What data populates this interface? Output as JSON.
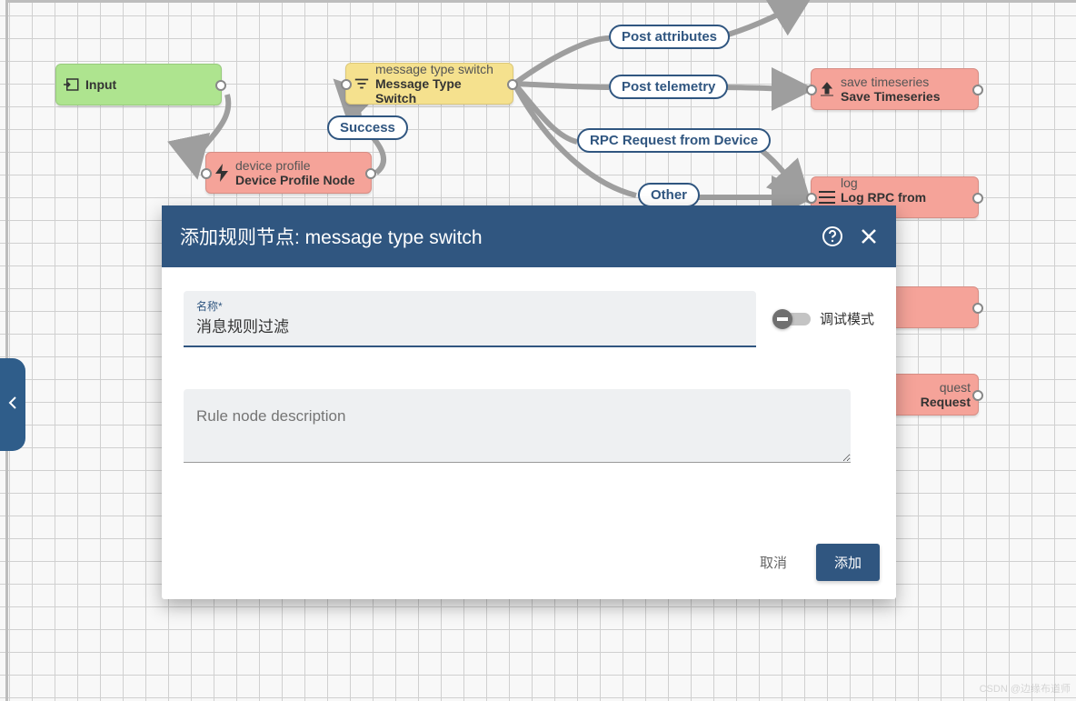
{
  "nodes": {
    "input": {
      "label": "Input"
    },
    "switch": {
      "top": "message type switch",
      "bot": "Message Type Switch"
    },
    "device": {
      "top": "device profile",
      "bot": "Device Profile Node"
    },
    "save_ts": {
      "top": "save timeseries",
      "bot": "Save Timeseries"
    },
    "log": {
      "top": "log",
      "bot": "Log RPC from Device"
    },
    "partial1": {
      "top": "quest",
      "bot": "Request"
    }
  },
  "links": {
    "success": "Success",
    "post_attrs": "Post attributes",
    "post_telemetry": "Post telemetry",
    "rpc_request": "RPC Request from Device",
    "other": "Other"
  },
  "modal": {
    "title": "添加规则节点: message type switch",
    "name_label": "名称*",
    "name_value": "消息规则过滤",
    "debug_label": "调试模式",
    "description_placeholder": "Rule node description",
    "cancel": "取消",
    "add": "添加"
  },
  "watermark": "CSDN @边缘布道师"
}
